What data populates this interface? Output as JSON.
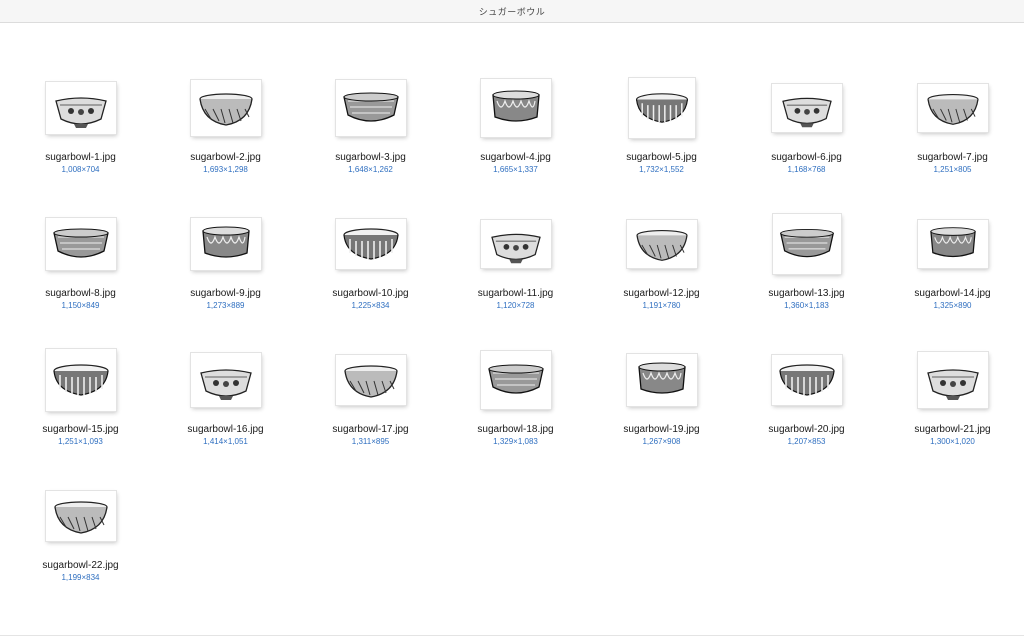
{
  "window": {
    "title": "シュガーボウル"
  },
  "files": [
    {
      "name": "sugarbowl-1.jpg",
      "dims": "1,008×704",
      "icon": "sugar-bowl-thumbnail"
    },
    {
      "name": "sugarbowl-2.jpg",
      "dims": "1,693×1,298",
      "icon": "sugar-bowl-thumbnail"
    },
    {
      "name": "sugarbowl-3.jpg",
      "dims": "1,648×1,262",
      "icon": "sugar-bowl-thumbnail"
    },
    {
      "name": "sugarbowl-4.jpg",
      "dims": "1,665×1,337",
      "icon": "sugar-bowl-thumbnail"
    },
    {
      "name": "sugarbowl-5.jpg",
      "dims": "1,732×1,552",
      "icon": "sugar-bowl-thumbnail"
    },
    {
      "name": "sugarbowl-6.jpg",
      "dims": "1,168×768",
      "icon": "sugar-bowl-thumbnail"
    },
    {
      "name": "sugarbowl-7.jpg",
      "dims": "1,251×805",
      "icon": "sugar-bowl-thumbnail"
    },
    {
      "name": "sugarbowl-8.jpg",
      "dims": "1,150×849",
      "icon": "sugar-bowl-thumbnail"
    },
    {
      "name": "sugarbowl-9.jpg",
      "dims": "1,273×889",
      "icon": "sugar-bowl-thumbnail"
    },
    {
      "name": "sugarbowl-10.jpg",
      "dims": "1,225×834",
      "icon": "sugar-bowl-thumbnail"
    },
    {
      "name": "sugarbowl-11.jpg",
      "dims": "1,120×728",
      "icon": "sugar-bowl-thumbnail"
    },
    {
      "name": "sugarbowl-12.jpg",
      "dims": "1,191×780",
      "icon": "sugar-bowl-thumbnail"
    },
    {
      "name": "sugarbowl-13.jpg",
      "dims": "1,360×1,183",
      "icon": "sugar-bowl-thumbnail"
    },
    {
      "name": "sugarbowl-14.jpg",
      "dims": "1,325×890",
      "icon": "sugar-bowl-thumbnail"
    },
    {
      "name": "sugarbowl-15.jpg",
      "dims": "1,251×1,093",
      "icon": "sugar-bowl-thumbnail"
    },
    {
      "name": "sugarbowl-16.jpg",
      "dims": "1,414×1,051",
      "icon": "sugar-bowl-thumbnail"
    },
    {
      "name": "sugarbowl-17.jpg",
      "dims": "1,311×895",
      "icon": "sugar-bowl-thumbnail"
    },
    {
      "name": "sugarbowl-18.jpg",
      "dims": "1,329×1,083",
      "icon": "sugar-bowl-thumbnail"
    },
    {
      "name": "sugarbowl-19.jpg",
      "dims": "1,267×908",
      "icon": "sugar-bowl-thumbnail"
    },
    {
      "name": "sugarbowl-20.jpg",
      "dims": "1,207×853",
      "icon": "sugar-bowl-thumbnail"
    },
    {
      "name": "sugarbowl-21.jpg",
      "dims": "1,300×1,020",
      "icon": "sugar-bowl-thumbnail"
    },
    {
      "name": "sugarbowl-22.jpg",
      "dims": "1,199×834",
      "icon": "sugar-bowl-thumbnail"
    }
  ],
  "colors": {
    "filename": "#1a1a1a",
    "dimensions": "#2f6fc0",
    "titlebar": "#f6f6f6"
  }
}
